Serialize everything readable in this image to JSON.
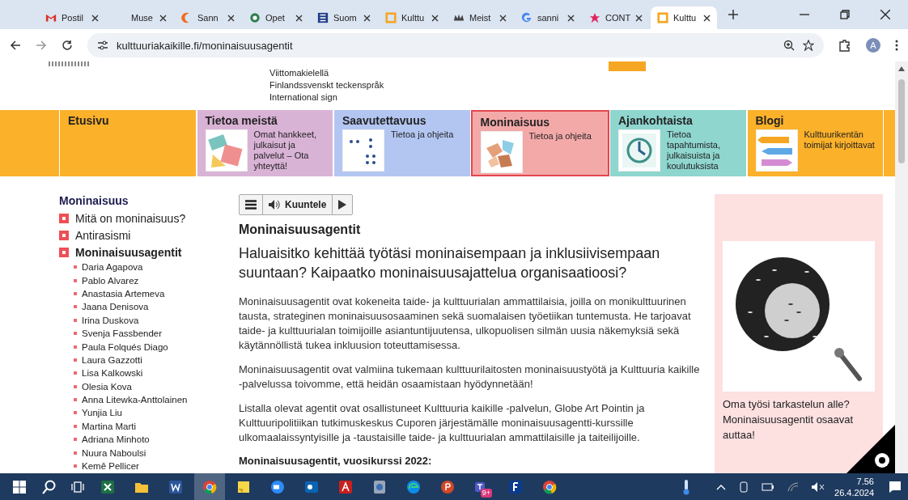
{
  "browser": {
    "tabs": [
      {
        "title": "Postil",
        "kind": "gmail",
        "selected": false
      },
      {
        "title": "Muse",
        "kind": "blank",
        "selected": false
      },
      {
        "title": "Sann",
        "kind": "crescent",
        "selected": false
      },
      {
        "title": "Opet",
        "kind": "globe",
        "selected": false
      },
      {
        "title": "Suom",
        "kind": "grid",
        "selected": false
      },
      {
        "title": "Kulttu",
        "kind": "frame",
        "selected": false
      },
      {
        "title": "Meist",
        "kind": "crown",
        "selected": false
      },
      {
        "title": "sanni",
        "kind": "google",
        "selected": false
      },
      {
        "title": "CONT",
        "kind": "star",
        "selected": false
      },
      {
        "title": "Kulttu",
        "kind": "frame",
        "selected": true
      }
    ],
    "url": "kulttuuriakaikille.fi/moninaisuusagentit",
    "profile": "A"
  },
  "header": {
    "sign_language_links": [
      "Viittomakielellä",
      "Finlandssvenskt teckenspråk",
      "International sign"
    ]
  },
  "nav": [
    {
      "title": "Etusivu",
      "color": "#fbb12a",
      "selected": false
    },
    {
      "title": "Tietoa meistä",
      "description": "Omat hankkeet, julkaisut ja palvelut – Ota yhteyttä!",
      "color": "#d9b3d6",
      "kind": "shapes",
      "selected": false
    },
    {
      "title": "Saavutettavuus",
      "description": "Tietoa ja ohjeita",
      "color": "#b3c6f2",
      "kind": "braille",
      "selected": false
    },
    {
      "title": "Moninaisuus",
      "description": "Tietoa ja ohjeita",
      "color": "#f4a9a9",
      "kind": "hands",
      "selected": true
    },
    {
      "title": "Ajankohtaista",
      "description": "Tietoa tapahtumista, julkaisuista ja koulutuksista",
      "color": "#8fd6cf",
      "kind": "clock",
      "selected": false
    },
    {
      "title": "Blogi",
      "description": "Kulttuurikentän toimijat kirjoittavat",
      "color": "#fbb12a",
      "kind": "pencils",
      "selected": false
    }
  ],
  "sidebar": {
    "heading": "Moninaisuus",
    "items": [
      {
        "label": "Mitä on moninaisuus?",
        "selected": false
      },
      {
        "label": "Antirasismi",
        "selected": false
      },
      {
        "label": "Moninaisuusagentit",
        "selected": true,
        "children": [
          {
            "label": "Daria Agapova"
          },
          {
            "label": "Pablo Alvarez"
          },
          {
            "label": "Anastasia Artemeva"
          },
          {
            "label": "Jaana Denisova"
          },
          {
            "label": "Irina Duskova"
          },
          {
            "label": "Svenja Fassbender"
          },
          {
            "label": "Paula Folqués Diago"
          },
          {
            "label": "Laura Gazzotti"
          },
          {
            "label": "Lisa Kalkowski"
          },
          {
            "label": "Olesia Kova"
          },
          {
            "label": "Anna Litewka-Anttolainen"
          },
          {
            "label": "Yunjia Liu"
          },
          {
            "label": "Martina Marti"
          },
          {
            "label": "Adriana Minhoto"
          },
          {
            "label": "Nuura Naboulsi"
          },
          {
            "label": "Kemê Pellicer"
          }
        ]
      }
    ]
  },
  "player": {
    "label": "Kuuntele"
  },
  "article": {
    "title": "Moninaisuusagentit",
    "lead": "Haluaisitko kehittää työtäsi moninaisempaan ja inklusiivisempaan suuntaan? Kaipaatko moninaisuusajattelua organisaatioosi?",
    "paragraphs": [
      "Moninaisuusagentit ovat kokeneita taide- ja kulttuurialan ammattilaisia, joilla on monikulttuurinen tausta, strateginen moninaisuusosaaminen sekä suomalaisen työetiikan tuntemusta. He tarjoavat taide- ja kulttuurialan toimijoille asiantuntijuutensa, ulkopuolisen silmän uusia näkemyksiä sekä käytännöllistä tukea inkluusion toteuttamisessa.",
      "Moninaisuusagentit ovat valmiina tukemaan kulttuurilaitosten moninaisuustyötä ja Kulttuuria kaikille -palvelussa toivomme, että heidän osaamistaan hyödynnetään!",
      "Listalla olevat agentit ovat osallistuneet Kulttuuria kaikille -palvelun, Globe Art Pointin ja Kulttuuripolitiikan tutkimuskeskus Cuporen järjestämälle moninaisuusagentti-kurssille ulkomaalaissyntyisille ja -taustaisille taide- ja kulttuurialan ammattilaisille ja taiteilijoille."
    ],
    "subheading": "Moninaisuusagentit, vuosikurssi 2022:"
  },
  "side_card": {
    "caption": "Oma työsi tarkastelun alle? Moninaisuusagentit osaavat auttaa!"
  },
  "taskbar": {
    "apps": [
      {
        "kind": "excel",
        "selected": false
      },
      {
        "kind": "files",
        "selected": false
      },
      {
        "kind": "word",
        "selected": false
      },
      {
        "kind": "chrome",
        "selected": true
      },
      {
        "kind": "notes",
        "selected": false
      },
      {
        "kind": "zoom",
        "selected": false
      },
      {
        "kind": "outlook",
        "selected": false
      },
      {
        "kind": "acrobat",
        "selected": false
      },
      {
        "kind": "app",
        "selected": false
      },
      {
        "kind": "edge",
        "selected": false
      },
      {
        "kind": "powerpoint",
        "selected": false
      },
      {
        "kind": "teams",
        "selected": false,
        "badge": "9+"
      },
      {
        "kind": "fapp",
        "selected": false
      },
      {
        "kind": "chrome",
        "selected": false
      }
    ],
    "time": "7.56",
    "date": "26.4.2024"
  }
}
